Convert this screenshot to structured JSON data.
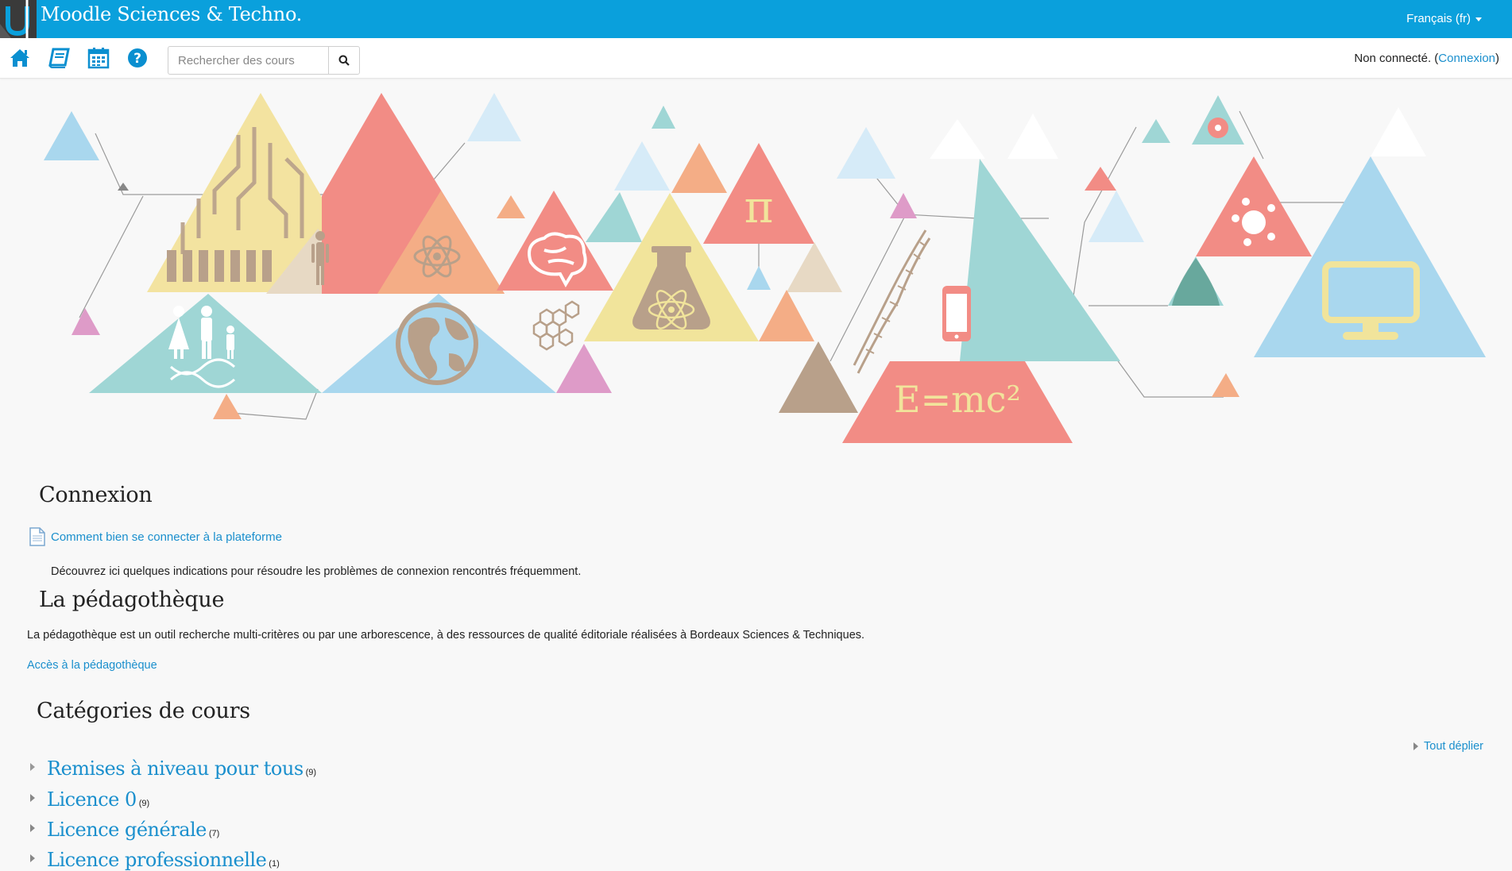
{
  "topbar": {
    "site_title": "Moodle Sciences & Techno.",
    "language": "Français (fr)",
    "colors": {
      "bar": "#0aa0dc",
      "logo_bg": "#3a3a3a"
    }
  },
  "navbar": {
    "icons": [
      "home-icon",
      "book-icon",
      "calendar-icon",
      "help-icon"
    ],
    "search_placeholder": "Rechercher des cours",
    "login_prefix": "Non connecté. (",
    "login_link": "Connexion",
    "login_suffix": ")"
  },
  "banner": {
    "formula": "E=mc²",
    "pi": "π"
  },
  "sections": {
    "connexion": {
      "title": "Connexion",
      "activity_label": "Comment bien se connecter à la plateforme",
      "summary": "Découvrez ici quelques indications pour résoudre les problèmes de connexion rencontrés fréquemment."
    },
    "pedagotheque": {
      "title": "La pédagothèque",
      "text": "La pédagothèque est un outil recherche multi-critères ou par une arborescence, à des ressources  de qualité éditoriale réalisées à Bordeaux Sciences & Techniques.",
      "link": "Accès à la pédagothèque"
    },
    "categories": {
      "title": "Catégories de cours",
      "expand_all": "Tout déplier",
      "items": [
        {
          "name": "Remises à niveau pour tous",
          "count": "(9)"
        },
        {
          "name": "Licence 0",
          "count": "(9)"
        },
        {
          "name": "Licence générale",
          "count": "(7)"
        },
        {
          "name": "Licence professionnelle",
          "count": "(1)"
        }
      ]
    }
  },
  "colors": {
    "link": "#1a8fcd",
    "background": "#f8f8f8"
  }
}
